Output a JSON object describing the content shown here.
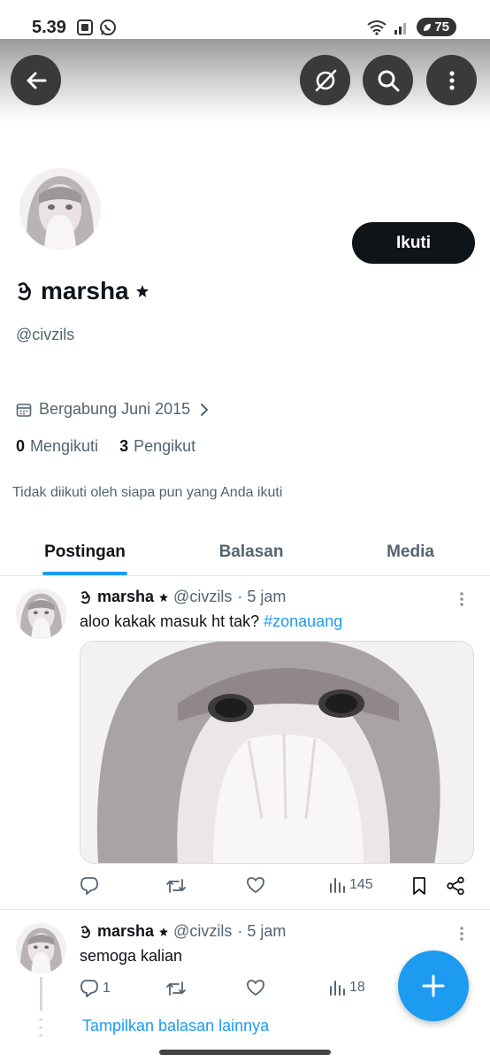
{
  "status_bar": {
    "time": "5.39",
    "battery": "75"
  },
  "header": {
    "back_icon": "arrow-left-icon",
    "actions": [
      "grok-icon",
      "search-icon",
      "more-vertical-icon"
    ]
  },
  "profile": {
    "name": "marsha",
    "name_prefix_icon": "curl-icon",
    "name_suffix_icon": "star-icon",
    "handle": "@civzils",
    "follow_label": "Ikuti",
    "joined": "Bergabung Juni 2015",
    "following_count": "0",
    "following_label": "Mengikuti",
    "followers_count": "3",
    "followers_label": "Pengikut",
    "followed_note": "Tidak diikuti oleh siapa pun yang Anda ikuti"
  },
  "tabs": [
    {
      "label": "Postingan",
      "active": true
    },
    {
      "label": "Balasan",
      "active": false
    },
    {
      "label": "Media",
      "active": false
    }
  ],
  "posts": [
    {
      "name": "marsha",
      "handle": "@civzils",
      "time": "· 5 jam",
      "text": "aloo kakak masuk ht tak?",
      "hashtag": "#zonauang",
      "has_media": true,
      "actions": {
        "replies": "",
        "reposts": "",
        "likes": "",
        "views": "145"
      }
    },
    {
      "name": "marsha",
      "handle": "@civzils",
      "time": "· 5 jam",
      "text": "semoga kalian",
      "has_media": false,
      "actions": {
        "replies": "1",
        "reposts": "",
        "likes": "",
        "views": "18"
      }
    }
  ],
  "show_more": "Tampilkan balasan lainnya",
  "colors": {
    "accent": "#1d9bf0",
    "text": "#0f1419",
    "muted": "#536471",
    "button": "#0f1419"
  }
}
